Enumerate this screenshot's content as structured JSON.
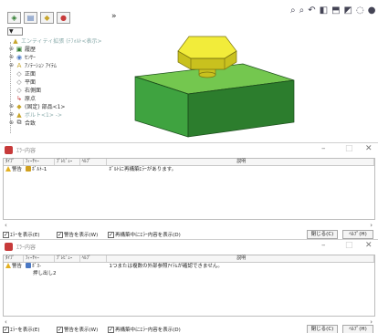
{
  "tree": {
    "more": "»",
    "filter": "▼",
    "items": [
      {
        "label": "エンティティ拡張 (ﾃﾌｫﾙﾄ<表示>",
        "icon": "part-warning-icon",
        "color": "#c7a52b",
        "faded": true
      },
      {
        "label": "履歴",
        "icon": "history-icon",
        "color": "#2d7a2d"
      },
      {
        "label": "ｾﾝｻｰ",
        "icon": "sensor-icon",
        "color": "#4a78c4"
      },
      {
        "label": "ｱﾉﾃｰｼｮﾝ ｱｲﾃﾑ",
        "icon": "annotation-icon",
        "color": "#c7a52b"
      },
      {
        "label": "正面",
        "icon": "plane-icon",
        "color": "#6a6a6a"
      },
      {
        "label": "平面",
        "icon": "plane-icon",
        "color": "#6a6a6a"
      },
      {
        "label": "右側面",
        "icon": "plane-icon",
        "color": "#6a6a6a"
      },
      {
        "label": "原点",
        "icon": "origin-icon",
        "color": "#c73a3a"
      },
      {
        "label": "(固定) 部品<1>",
        "icon": "part-icon",
        "color": "#c7a52b"
      },
      {
        "label": "ボルト<1> ->",
        "icon": "part-warning-icon",
        "color": "#c7a52b",
        "faded": true
      },
      {
        "label": "合致",
        "icon": "mates-icon",
        "color": "#555555"
      }
    ]
  },
  "colors": {
    "block_front": "#3fa340",
    "block_top": "#74c74f",
    "block_side": "#2c7d2d",
    "nut_top": "#f2ec3a",
    "nut_side": "#c9c11e",
    "error_icon": "#c73a3a",
    "warning": "#e3b021"
  },
  "dialogs": [
    {
      "title": "ｴﾗｰ内容",
      "columns": [
        "ﾀｲﾌﾟ",
        "ﾌｨｰﾁｬｰ",
        "ﾌﾟﾚﾋﾞｭｰ",
        "ﾍﾙﾌﾟ",
        "説明"
      ],
      "row": {
        "type": "警告",
        "feature": "ﾎﾞﾙﾄ-1",
        "feature2": "",
        "preview": "",
        "help": "",
        "desc": "ﾎﾞﾙﾄに再構築ｴﾗｰがあります。"
      },
      "show_errors": "ｴﾗｰを表示(E)",
      "show_warnings": "警告を表示(W)",
      "show_rebuild": "再構築中にｴﾗｰ内容を表示(D)",
      "close": "閉じる(C)",
      "help_btn": "ﾍﾙﾌﾟ(H)"
    },
    {
      "title": "ｴﾗｰ内容",
      "columns": [
        "ﾀｲﾌﾟ",
        "ﾌｨｰﾁｬｰ",
        "ﾌﾟﾚﾋﾞｭｰ",
        "ﾍﾙﾌﾟ",
        "説明"
      ],
      "row": {
        "type": "警告",
        "feature": "ﾎﾞｽ-",
        "feature2": "押し出し2",
        "preview": "",
        "help": "",
        "desc": "1つまたは複数の外部参照ｱｲﾃﾑが確認できません。"
      },
      "show_errors": "ｴﾗｰを表示(E)",
      "show_warnings": "警告を表示(W)",
      "show_rebuild": "再構築中にｴﾗｰ内容を表示(D)",
      "close": "閉じる(C)",
      "help_btn": "ﾍﾙﾌﾟ(H)"
    }
  ]
}
